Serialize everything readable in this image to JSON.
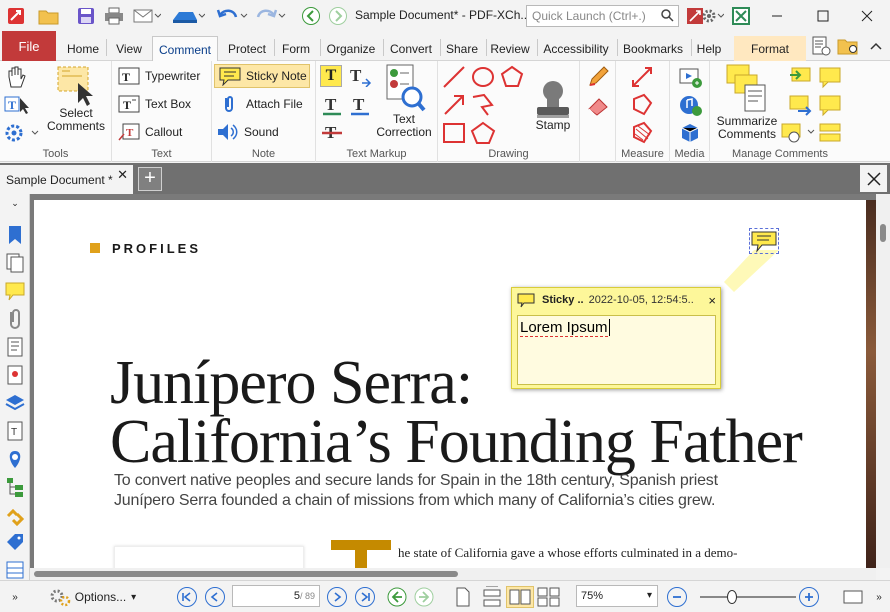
{
  "titlebar": {
    "doc_title": "Sample Document* - PDF-XCh..",
    "quick_launch_placeholder": "Quick Launch (Ctrl+.)"
  },
  "tabs": [
    {
      "label": "File"
    },
    {
      "label": "Home"
    },
    {
      "label": "View"
    },
    {
      "label": "Comment"
    },
    {
      "label": "Protect"
    },
    {
      "label": "Form"
    },
    {
      "label": "Organize"
    },
    {
      "label": "Convert"
    },
    {
      "label": "Share"
    },
    {
      "label": "Review"
    },
    {
      "label": "Accessibility"
    },
    {
      "label": "Bookmarks"
    },
    {
      "label": "Help"
    },
    {
      "label": "Format"
    }
  ],
  "ribbon": {
    "groups": {
      "tools": "Tools",
      "text": "Text",
      "note": "Note",
      "text_markup": "Text Markup",
      "drawing": "Drawing",
      "measure": "Measure",
      "media": "Media",
      "manage": "Manage Comments"
    },
    "select_comments": "Select Comments",
    "typewriter": "Typewriter",
    "text_box": "Text Box",
    "callout": "Callout",
    "sticky_note": "Sticky Note",
    "attach_file": "Attach File",
    "sound": "Sound",
    "text_correction": "Text Correction",
    "stamp": "Stamp",
    "summarize": "Summarize Comments"
  },
  "doc_tab": {
    "label": "Sample Document *"
  },
  "page": {
    "section_label": "PROFILES",
    "headline_1": "Junípero Serra:",
    "headline_2": "California’s Founding Father",
    "sub_1": "To convert native peoples and secure lands for Spain in the 18th century, Spanish priest",
    "sub_2": "Junípero Serra founded a chain of missions from which many of California’s cities grew.",
    "body_snippet": "he state of California gave a     whose efforts culminated in a demo-"
  },
  "sticky": {
    "author": "Sticky ..",
    "date": "2022-10-05, 12:54:5..",
    "close": "×",
    "text": "Lorem Ipsum",
    "color": "#fdf79a"
  },
  "statusbar": {
    "options": "Options...",
    "page_current": "5",
    "page_total": "/ 89",
    "zoom": "75%",
    "zoom_fraction": 0.33
  }
}
